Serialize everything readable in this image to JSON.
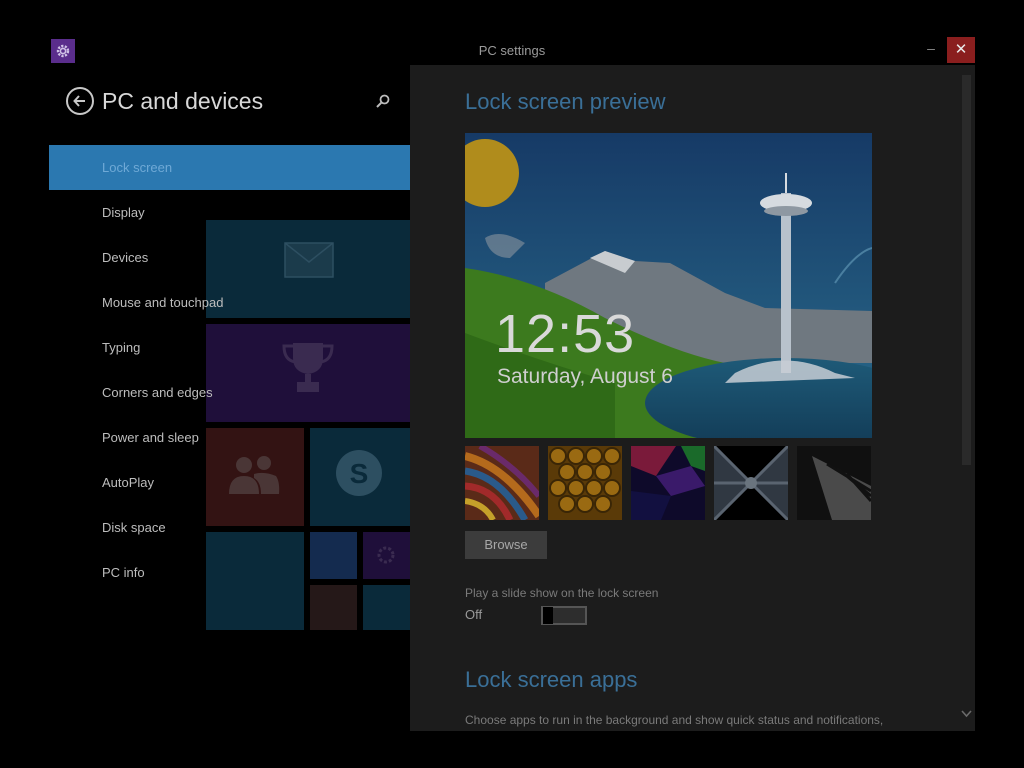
{
  "window": {
    "title": "PC settings",
    "minimize_glyph": "–",
    "close_glyph": "✕",
    "icon": "gear-icon"
  },
  "left_pane": {
    "title": "PC and devices",
    "back_icon": "back-arrow-icon",
    "search_icon": "search-icon",
    "nav_items": [
      {
        "label": "Lock screen",
        "selected": true
      },
      {
        "label": "Display",
        "selected": false
      },
      {
        "label": "Devices",
        "selected": false
      },
      {
        "label": "Mouse and touchpad",
        "selected": false
      },
      {
        "label": "Typing",
        "selected": false
      },
      {
        "label": "Corners and edges",
        "selected": false
      },
      {
        "label": "Power and sleep",
        "selected": false
      },
      {
        "label": "AutoPlay",
        "selected": false
      },
      {
        "label": "Disk space",
        "selected": false
      },
      {
        "label": "PC info",
        "selected": false
      }
    ]
  },
  "content": {
    "preview_heading": "Lock screen preview",
    "preview_time": "12:53",
    "preview_date": "Saturday, August 6",
    "thumbnails": [
      "rainbow-stripes",
      "honeycomb",
      "color-blocks",
      "tunnel",
      "piano-keys"
    ],
    "browse_label": "Browse",
    "slideshow_label": "Play a slide show on the lock screen",
    "slideshow_state": "Off",
    "slideshow_on": false,
    "apps_heading": "Lock screen apps",
    "apps_description": "Choose apps to run in the background and show quick status and notifications,"
  },
  "colors": {
    "accent": "#2b78b0",
    "heading": "#3a6f97",
    "close": "#8a1e1e"
  }
}
